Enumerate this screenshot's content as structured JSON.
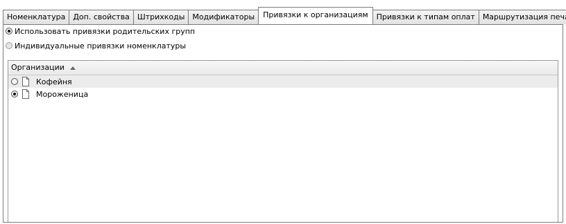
{
  "tabs": [
    {
      "label": "Номенклатура",
      "active": false
    },
    {
      "label": "Доп. свойства",
      "active": false
    },
    {
      "label": "Штрихкоды",
      "active": false
    },
    {
      "label": "Модификаторы",
      "active": false
    },
    {
      "label": "Привязки к организациям",
      "active": true
    },
    {
      "label": "Привязки к типам оплат",
      "active": false
    },
    {
      "label": "Маршрутизация печати",
      "active": false
    }
  ],
  "binding_mode": {
    "options": [
      {
        "label": "Использовать привязки родительских групп",
        "checked": true
      },
      {
        "label": "Индивидуальные привязки номенклатуры",
        "checked": false
      }
    ]
  },
  "organizations": {
    "column_header": "Организации",
    "sort": "ascending",
    "sort_icon": "sort-ascending-icon",
    "row_icon": "document-icon",
    "rows": [
      {
        "label": "Кофейня",
        "checked": false,
        "highlighted": true
      },
      {
        "label": "Мороженица",
        "checked": true,
        "highlighted": false
      }
    ]
  }
}
